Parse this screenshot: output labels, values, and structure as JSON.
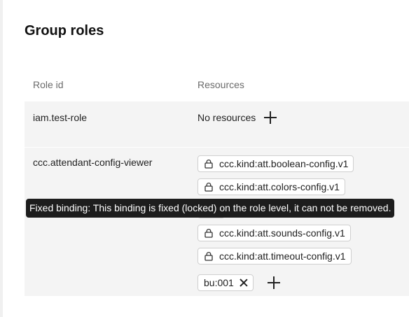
{
  "page": {
    "title": "Group roles"
  },
  "table": {
    "headers": {
      "role_id": "Role id",
      "resources": "Resources"
    },
    "rows": [
      {
        "role": "iam.test-role",
        "no_resources_label": "No resources"
      },
      {
        "role": "ccc.attendant-config-viewer",
        "locked_resources": [
          "ccc.kind:att.boolean-config.v1",
          "ccc.kind:att.colors-config.v1",
          "",
          "ccc.kind:att.sounds-config.v1",
          "ccc.kind:att.timeout-config.v1"
        ],
        "removable_resource": "bu:001"
      }
    ]
  },
  "tooltip": {
    "text": "Fixed binding: This binding is fixed (locked) on the role level, it can not be removed."
  }
}
